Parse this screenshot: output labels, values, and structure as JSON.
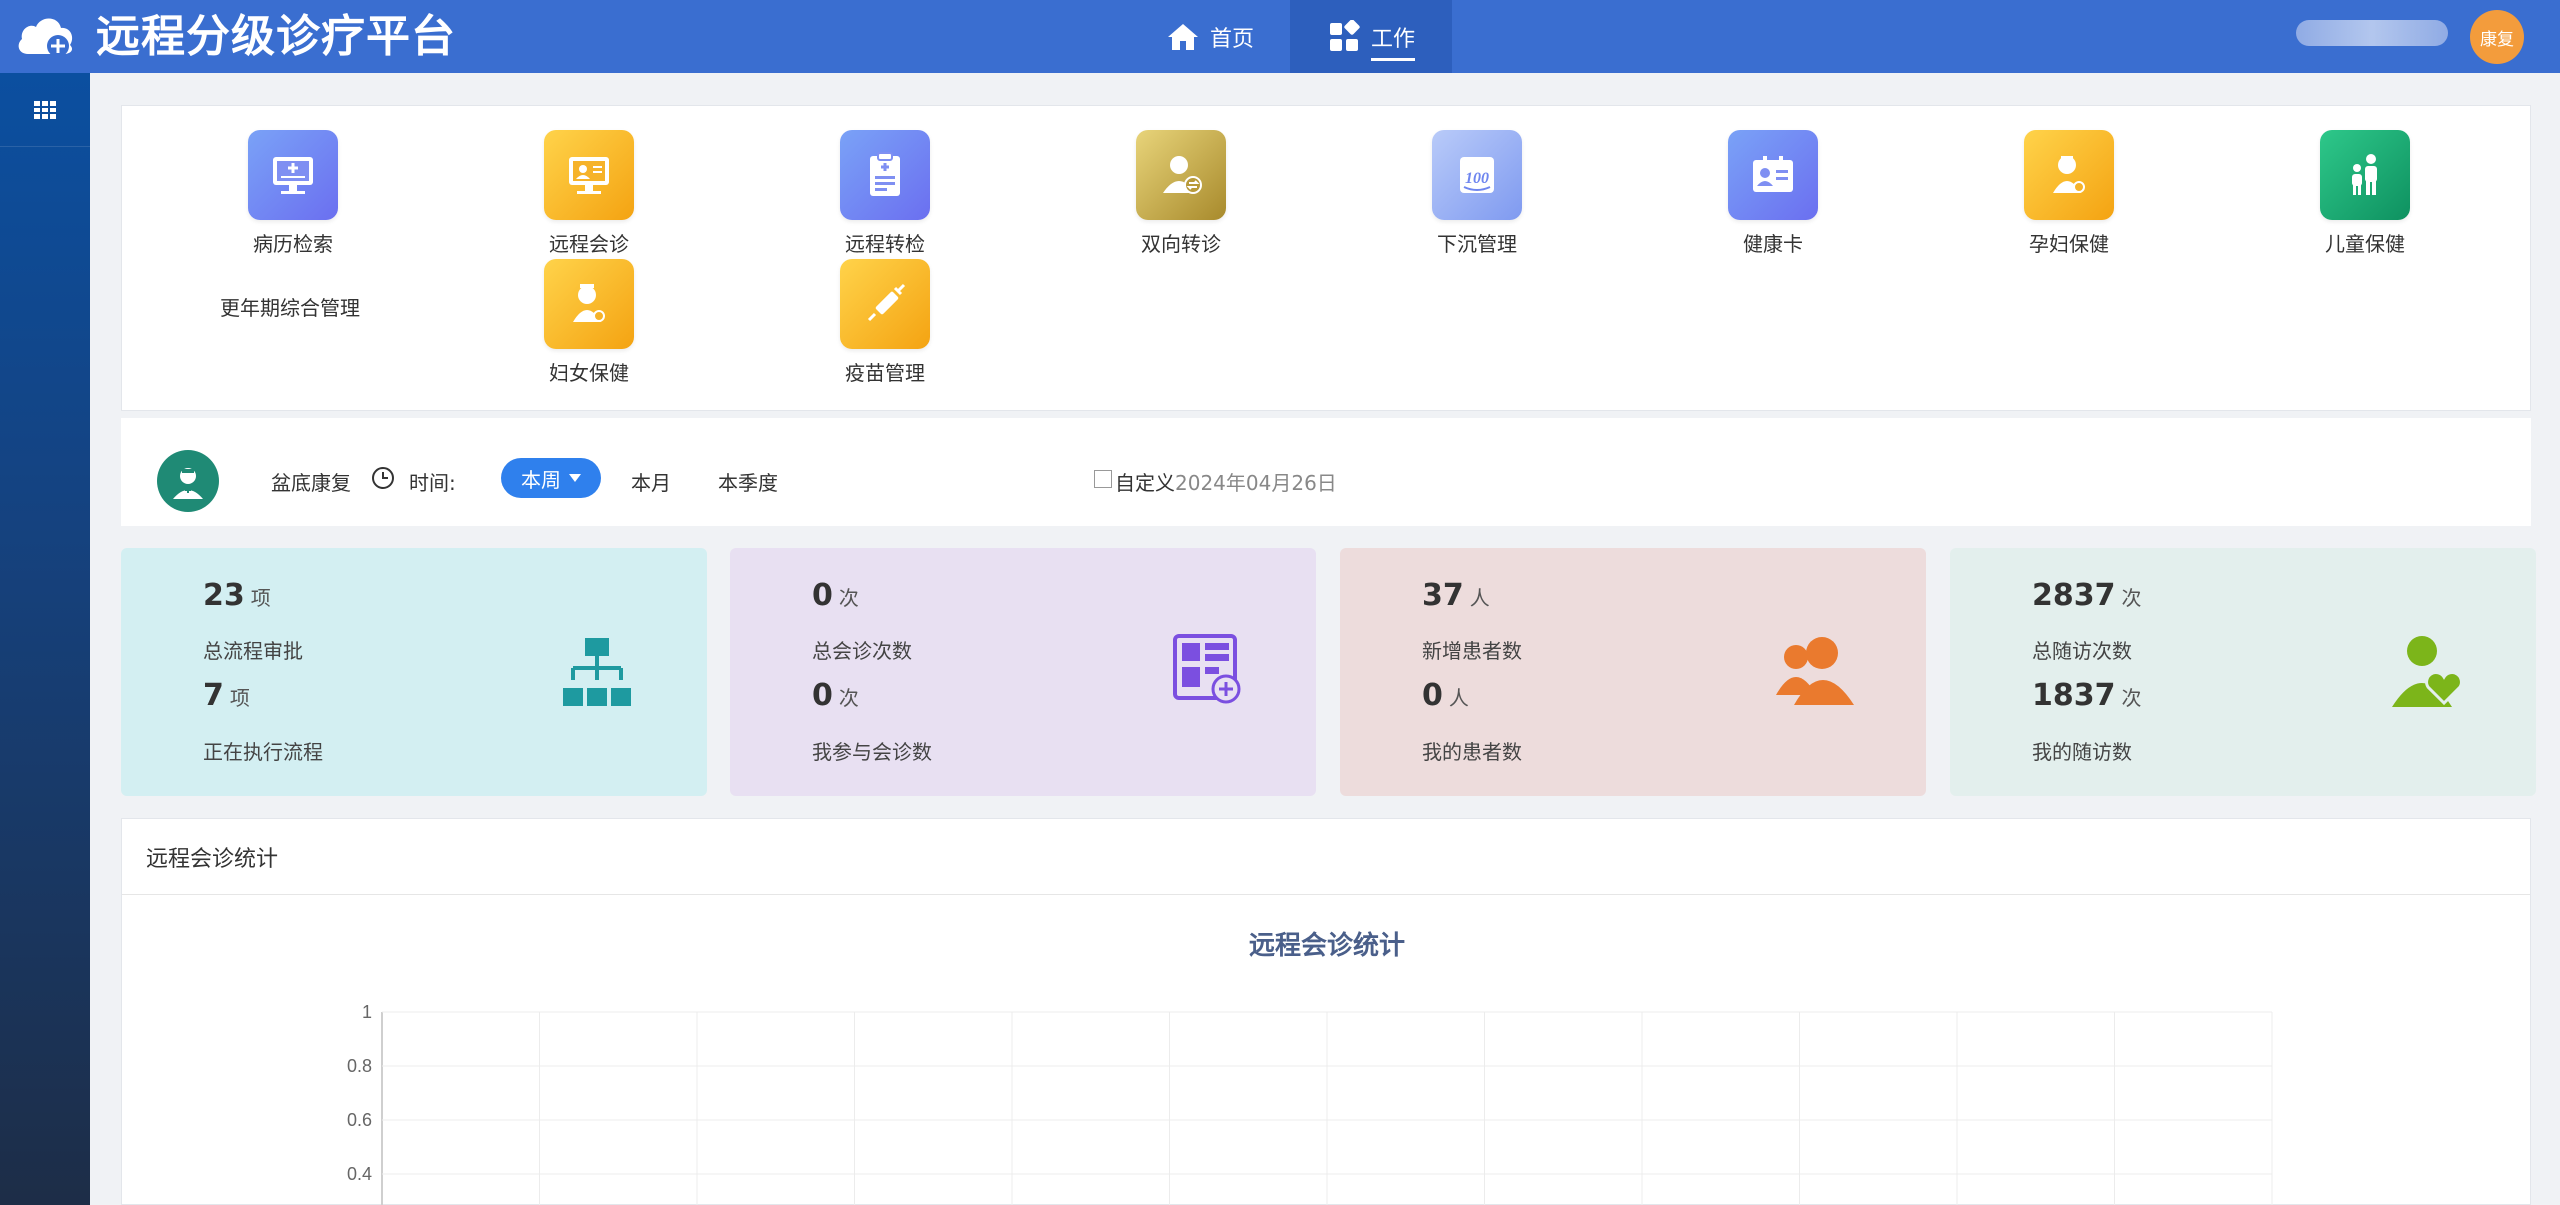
{
  "header": {
    "title": "远程分级诊疗平台",
    "nav": [
      {
        "label": "首页",
        "icon": "home-icon",
        "active": false
      },
      {
        "label": "工作",
        "icon": "dashboard-grid-icon",
        "active": true
      }
    ],
    "user_avatar_text": "康复"
  },
  "sidebar": {
    "items": [
      {
        "icon": "apps-grid-icon"
      }
    ]
  },
  "quick_apps": {
    "items": [
      {
        "label": "病历检索",
        "icon": "medical-record-search-icon",
        "color": "#6f86ef"
      },
      {
        "label": "远程会诊",
        "icon": "remote-consultation-icon",
        "color": "#f5b21f"
      },
      {
        "label": "远程转检",
        "icon": "remote-referral-check-icon",
        "color": "#6f86ef"
      },
      {
        "label": "双向转诊",
        "icon": "two-way-referral-icon",
        "color": "#c9a93d"
      },
      {
        "label": "下沉管理",
        "icon": "sinking-management-icon",
        "color": "#8faaf3"
      },
      {
        "label": "健康卡",
        "icon": "health-card-icon",
        "color": "#6f86ef"
      },
      {
        "label": "孕妇保健",
        "icon": "maternal-care-icon",
        "color": "#f5b21f"
      },
      {
        "label": "儿童保健",
        "icon": "child-care-icon",
        "color": "#18a374"
      },
      {
        "label": "更年期综合管理",
        "icon": "",
        "color": ""
      },
      {
        "label": "妇女保健",
        "icon": "women-care-icon",
        "color": "#f5b21f"
      },
      {
        "label": "疫苗管理",
        "icon": "vaccine-icon",
        "color": "#f5b21f"
      }
    ]
  },
  "filter": {
    "department": "盆底康复",
    "time_label": "时间:",
    "selected_period": "本周",
    "options": [
      "本月",
      "本季度"
    ],
    "custom_label": "自定义",
    "custom_date": "2024年04月26日"
  },
  "stats": [
    {
      "n1": "23",
      "u1": "项",
      "l1": "总流程审批",
      "n2": "7",
      "u2": "项",
      "l2": "正在执行流程",
      "bg": "#d3eff2",
      "icon": "flowchart-icon",
      "icon_color": "#1e9aa0"
    },
    {
      "n1": "0",
      "u1": "次",
      "l1": "总会诊次数",
      "n2": "0",
      "u2": "次",
      "l2": "我参与会诊数",
      "bg": "#e8e0f2",
      "icon": "add-consultation-icon",
      "icon_color": "#7b4fe0"
    },
    {
      "n1": "37",
      "u1": "人",
      "l1": "新增患者数",
      "n2": "0",
      "u2": "人",
      "l2": "我的患者数",
      "bg": "#eddcdc",
      "icon": "patients-icon",
      "icon_color": "#ea7a2e"
    },
    {
      "n1": "2837",
      "u1": "次",
      "l1": "总随访次数",
      "n2": "1837",
      "u2": "次",
      "l2": "我的随访数",
      "bg": "#e3efed",
      "icon": "follow-up-care-icon",
      "icon_color": "#7cb51a"
    }
  ],
  "chart_panel": {
    "header": "远程会诊统计"
  },
  "chart_data": {
    "type": "line",
    "title": "远程会诊统计",
    "y_ticks": [
      1,
      0.8,
      0.6,
      0.4
    ],
    "ylim": [
      0,
      1
    ],
    "categories_count": 12,
    "series": [],
    "grid": true
  }
}
